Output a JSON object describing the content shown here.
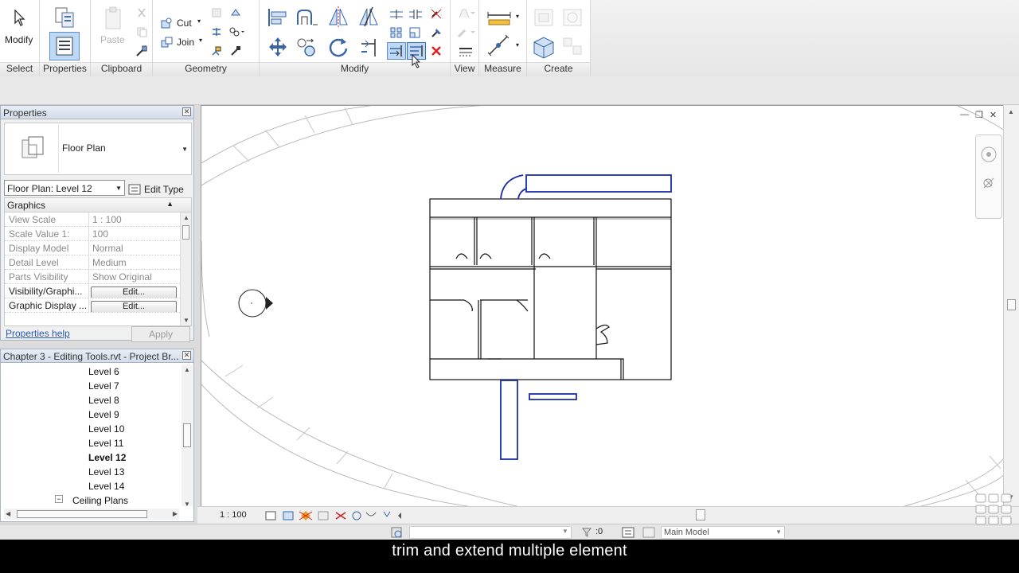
{
  "ribbon": {
    "panels": [
      {
        "label": "Select"
      },
      {
        "label": "Properties"
      },
      {
        "label": "Clipboard"
      },
      {
        "label": "Geometry"
      },
      {
        "label": "Modify"
      },
      {
        "label": "View"
      },
      {
        "label": "Measure"
      },
      {
        "label": "Create"
      }
    ],
    "select_button": "Modify",
    "clipboard_paste": "Paste",
    "geometry_cut": "Cut",
    "geometry_join": "Join"
  },
  "properties_palette": {
    "title": "Properties",
    "type_name": "Floor Plan",
    "instance_selector": "Floor Plan: Level 12",
    "edit_type": "Edit Type",
    "section": "Graphics",
    "rows": [
      {
        "key": "View Scale",
        "value": "1 : 100"
      },
      {
        "key": "Scale Value    1:",
        "value": "100"
      },
      {
        "key": "Display Model",
        "value": "Normal"
      },
      {
        "key": "Detail Level",
        "value": "Medium"
      },
      {
        "key": "Parts Visibility",
        "value": "Show Original"
      },
      {
        "key": "Visibility/Graphi...",
        "value": "Edit..."
      },
      {
        "key": "Graphic Display ...",
        "value": "Edit..."
      }
    ],
    "help_link": "Properties help",
    "apply": "Apply"
  },
  "project_browser": {
    "title": "Chapter 3 - Editing Tools.rvt - Project Br...",
    "items": [
      {
        "label": "Level 6",
        "bold": false
      },
      {
        "label": "Level 7",
        "bold": false
      },
      {
        "label": "Level 8",
        "bold": false
      },
      {
        "label": "Level 9",
        "bold": false
      },
      {
        "label": "Level 10",
        "bold": false
      },
      {
        "label": "Level 11",
        "bold": false
      },
      {
        "label": "Level 12",
        "bold": true
      },
      {
        "label": "Level 13",
        "bold": false
      },
      {
        "label": "Level 14",
        "bold": false
      }
    ],
    "group": "Ceiling Plans",
    "group_toggle": "−"
  },
  "view_control_bar": {
    "scale": "1 : 100"
  },
  "status_bar": {
    "count": ":0",
    "model": "Main Model"
  },
  "caption": "trim and extend multiple  element",
  "colors": {
    "selection_blue": "#1a2ea8",
    "accent_blue": "#3a76c4"
  }
}
